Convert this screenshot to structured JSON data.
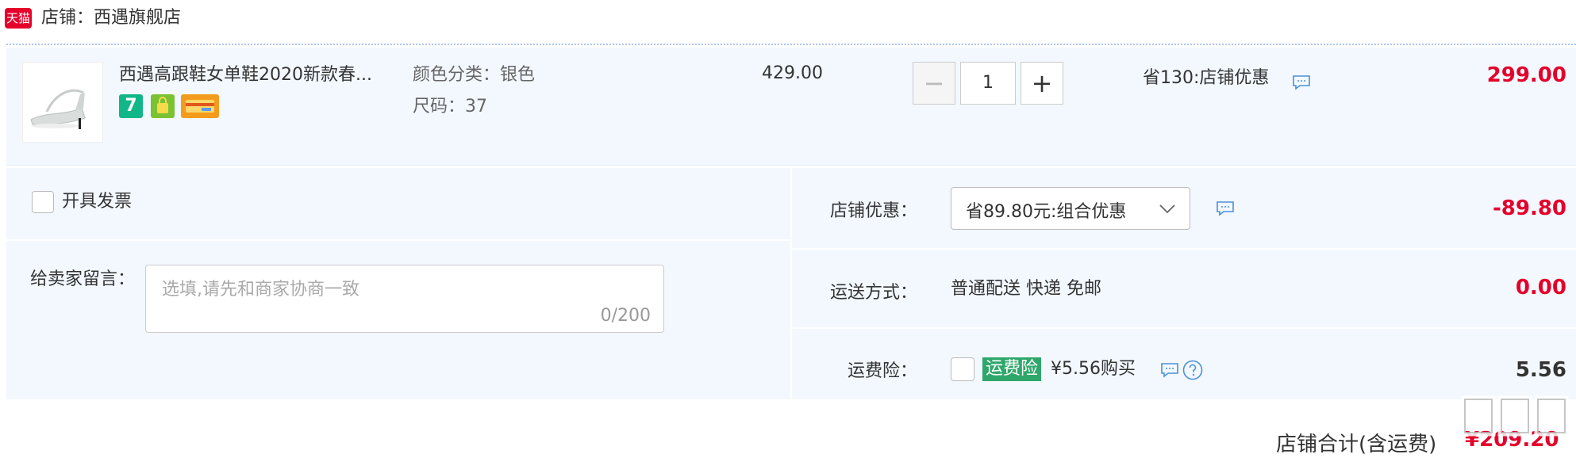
{
  "shop": {
    "logo_text": "天猫",
    "name": "店铺：西遇旗舰店"
  },
  "item": {
    "title": "西遇高跟鞋女单鞋2020新款春...",
    "sku_color": "颜色分类：银色",
    "sku_size": "尺码：37",
    "price": "429.00",
    "quantity": "1",
    "qty_minus": "−",
    "qty_plus": "+",
    "promo": "省130:店铺优惠",
    "subtotal": "299.00",
    "badges": [
      "7",
      "bag-icon",
      "card-icon"
    ]
  },
  "invoice": {
    "label": "开具发票"
  },
  "message": {
    "label": "给卖家留言：",
    "placeholder": "选填,请先和商家协商一致",
    "counter": "0/200"
  },
  "discount": {
    "label": "店铺优惠：",
    "selected": "省89.80元:组合优惠",
    "amount": "-89.80"
  },
  "shipping": {
    "label": "运送方式：",
    "method": "普通配送 快递 免邮",
    "amount": "0.00"
  },
  "insurance": {
    "label": "运费险：",
    "tag": "运费险",
    "price_text": "¥5.56购买",
    "amount": "5.56"
  },
  "total": {
    "label": "店铺合计(含运费)",
    "amount": "¥209.20"
  },
  "colors": {
    "brand_red": "#e4002b",
    "panel_bg": "#f3f8fe",
    "green": "#2fa76b"
  }
}
